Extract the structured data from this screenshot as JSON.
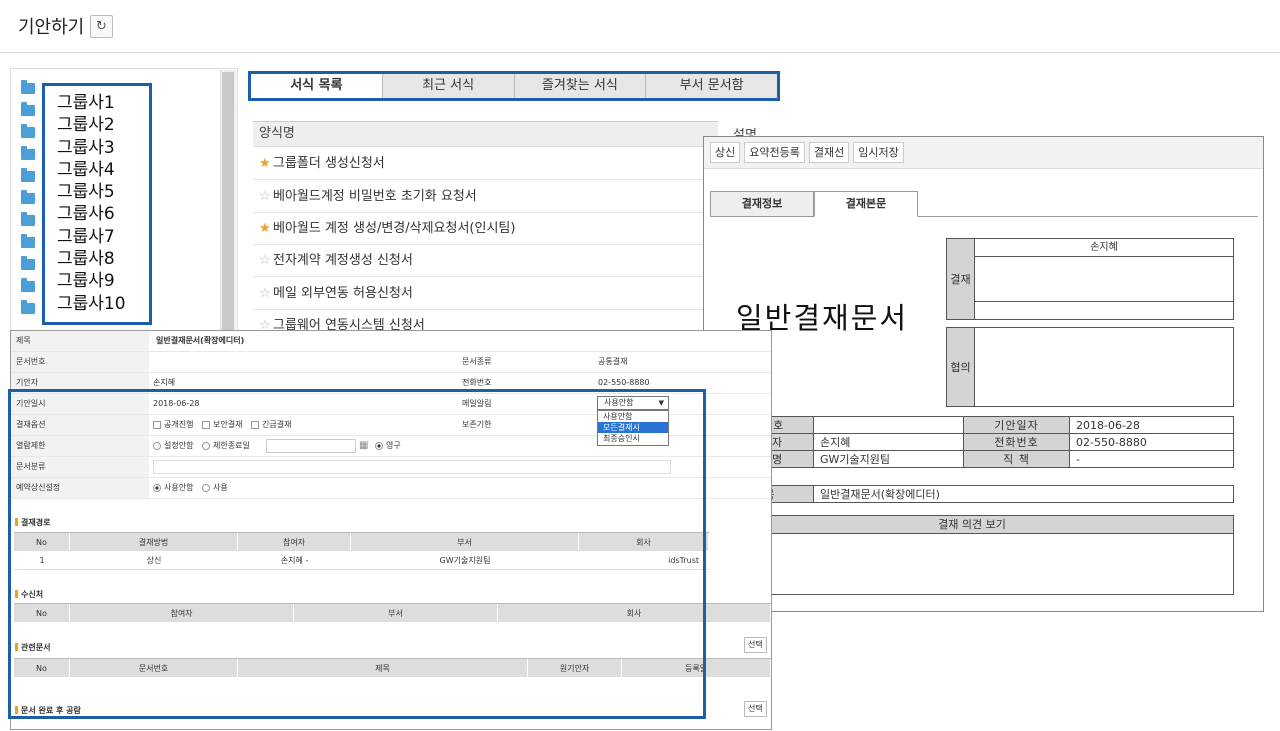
{
  "header": {
    "title": "기안하기",
    "refresh_icon": "refresh-icon"
  },
  "tree": {
    "groups": [
      "그룹사1",
      "그룹사2",
      "그룹사3",
      "그룹사4",
      "그룹사5",
      "그룹사6",
      "그룹사7",
      "그룹사8",
      "그룹사9",
      "그룹사10"
    ]
  },
  "tabs": [
    "서식 목록",
    "최근 서식",
    "즐겨찾는 서식",
    "부서 문서함"
  ],
  "form_list": {
    "column": "양식명",
    "column2": "설명",
    "items": [
      {
        "name": "그룹폴더 생성신청서",
        "fav": true
      },
      {
        "name": "베아월드계정 비밀번호 초기화 요청서",
        "fav": false
      },
      {
        "name": "베아월드 계정 생성/변경/삭제요청서(인시팀)",
        "fav": true
      },
      {
        "name": "전자계약 계정생성 신청서",
        "fav": false
      },
      {
        "name": "메일 외부연동 허용신청서",
        "fav": false
      },
      {
        "name": "그룹웨어 연동시스템 신청서",
        "fav": false
      }
    ]
  },
  "doc": {
    "toolbar": [
      "상신",
      "요약전등록",
      "결재선",
      "임시저장"
    ],
    "tabs": [
      "결재정보",
      "결재본문"
    ],
    "title": "일반결재문서",
    "approval_label": "결재",
    "approver": "손지혜",
    "consult_label": "협의",
    "info": {
      "doc_no_label": "문서번호",
      "doc_no": "",
      "draft_date_label": "기안일자",
      "draft_date": "2018-06-28",
      "drafter_label": "기 안 자",
      "drafter": "손지혜",
      "phone_label": "전화번호",
      "phone": "02-550-8880",
      "dept_label": "부 서 명",
      "dept": "GW기술지원팀",
      "position_label": "직 책",
      "position": "-",
      "subject_label": "제 목",
      "subject": "일반결재문서(확장에디터)",
      "opinion_label": "결재 의견 보기"
    }
  },
  "form": {
    "subject_label": "제목",
    "subject": "일반결재문서(확장에디터)",
    "doc_no_label": "문서번호",
    "doc_type_label": "문서종류",
    "doc_type": "공통결재",
    "drafter_label": "기안자",
    "drafter": "손지혜",
    "phone_label": "전화번호",
    "phone": "02-550-8880",
    "date_label": "기안일시",
    "date": "2018-06-28",
    "mail_label": "메일알림",
    "mail_value": "사용안함",
    "mail_options": [
      "사용안함",
      "모든결재시",
      "최종승인시"
    ],
    "options_label": "결재옵션",
    "options": [
      "공개진행",
      "보안결재",
      "긴급결재"
    ],
    "retention_label": "보존기한",
    "view_limit_label": "열람제한",
    "view_limit": [
      "설정안함",
      "제한종료일",
      "영구"
    ],
    "category_label": "문서분류",
    "reserve_label": "예약상신설정",
    "reserve": [
      "사용안함",
      "사용"
    ],
    "route_title": "결재경로",
    "route_cols": [
      "No",
      "결재방법",
      "참여자",
      "부서",
      "회사"
    ],
    "route_row": [
      "1",
      "상신",
      "손지혜 -",
      "GW기술지원팀",
      "idsTrust"
    ],
    "recv_title": "수신처",
    "recv_cols": [
      "No",
      "참여자",
      "부서",
      "회사"
    ],
    "related_title": "관련문서",
    "related_cols": [
      "No",
      "문서번호",
      "제목",
      "원기안자",
      "등록일"
    ],
    "share_title": "문서 완료 후 공람",
    "select_btn": "선택"
  }
}
